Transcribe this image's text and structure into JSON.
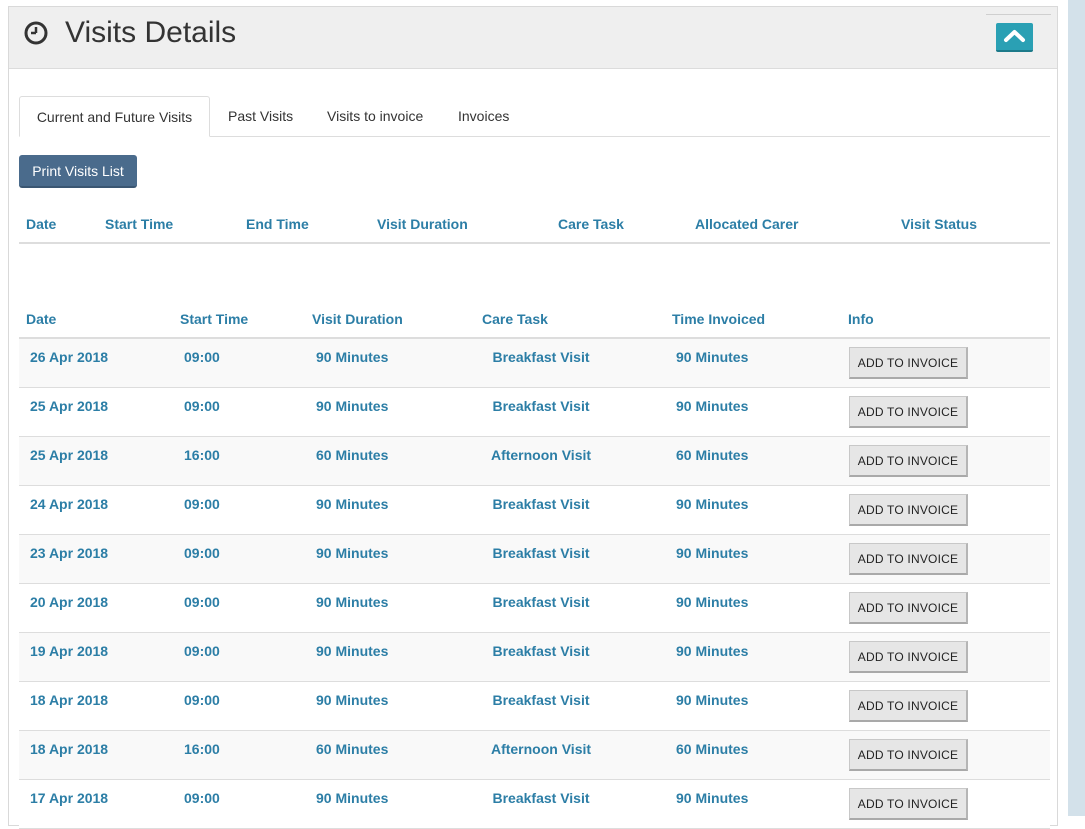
{
  "panel": {
    "title": "Visits Details",
    "icon": "clock-icon",
    "collapse_icon": "chevron-up-icon",
    "accent_color": "#2aa0b4"
  },
  "tabs": [
    {
      "label": "Current and Future Visits",
      "active": true
    },
    {
      "label": "Past Visits",
      "active": false
    },
    {
      "label": "Visits to invoice",
      "active": false
    },
    {
      "label": "Invoices",
      "active": false
    }
  ],
  "print_button": {
    "label": "Print Visits List"
  },
  "table1": {
    "headers": [
      "Date",
      "Start Time",
      "End Time",
      "Visit Duration",
      "Care Task",
      "Allocated Carer",
      "Visit Status"
    ]
  },
  "table2": {
    "headers": [
      "Date",
      "Start Time",
      "Visit Duration",
      "Care Task",
      "Time Invoiced",
      "Info"
    ],
    "action_label": "ADD TO INVOICE",
    "rows": [
      {
        "date": "26 Apr 2018",
        "start": "09:00",
        "duration": "90 Minutes",
        "task": "Breakfast Visit",
        "invoiced": "90 Minutes"
      },
      {
        "date": "25 Apr 2018",
        "start": "09:00",
        "duration": "90 Minutes",
        "task": "Breakfast Visit",
        "invoiced": "90 Minutes"
      },
      {
        "date": "25 Apr 2018",
        "start": "16:00",
        "duration": "60 Minutes",
        "task": "Afternoon Visit",
        "invoiced": "60 Minutes"
      },
      {
        "date": "24 Apr 2018",
        "start": "09:00",
        "duration": "90 Minutes",
        "task": "Breakfast Visit",
        "invoiced": "90 Minutes"
      },
      {
        "date": "23 Apr 2018",
        "start": "09:00",
        "duration": "90 Minutes",
        "task": "Breakfast Visit",
        "invoiced": "90 Minutes"
      },
      {
        "date": "20 Apr 2018",
        "start": "09:00",
        "duration": "90 Minutes",
        "task": "Breakfast Visit",
        "invoiced": "90 Minutes"
      },
      {
        "date": "19 Apr 2018",
        "start": "09:00",
        "duration": "90 Minutes",
        "task": "Breakfast Visit",
        "invoiced": "90 Minutes"
      },
      {
        "date": "18 Apr 2018",
        "start": "09:00",
        "duration": "90 Minutes",
        "task": "Breakfast Visit",
        "invoiced": "90 Minutes"
      },
      {
        "date": "18 Apr 2018",
        "start": "16:00",
        "duration": "60 Minutes",
        "task": "Afternoon Visit",
        "invoiced": "60 Minutes"
      },
      {
        "date": "17 Apr 2018",
        "start": "09:00",
        "duration": "90 Minutes",
        "task": "Breakfast Visit",
        "invoiced": "90 Minutes"
      }
    ]
  }
}
